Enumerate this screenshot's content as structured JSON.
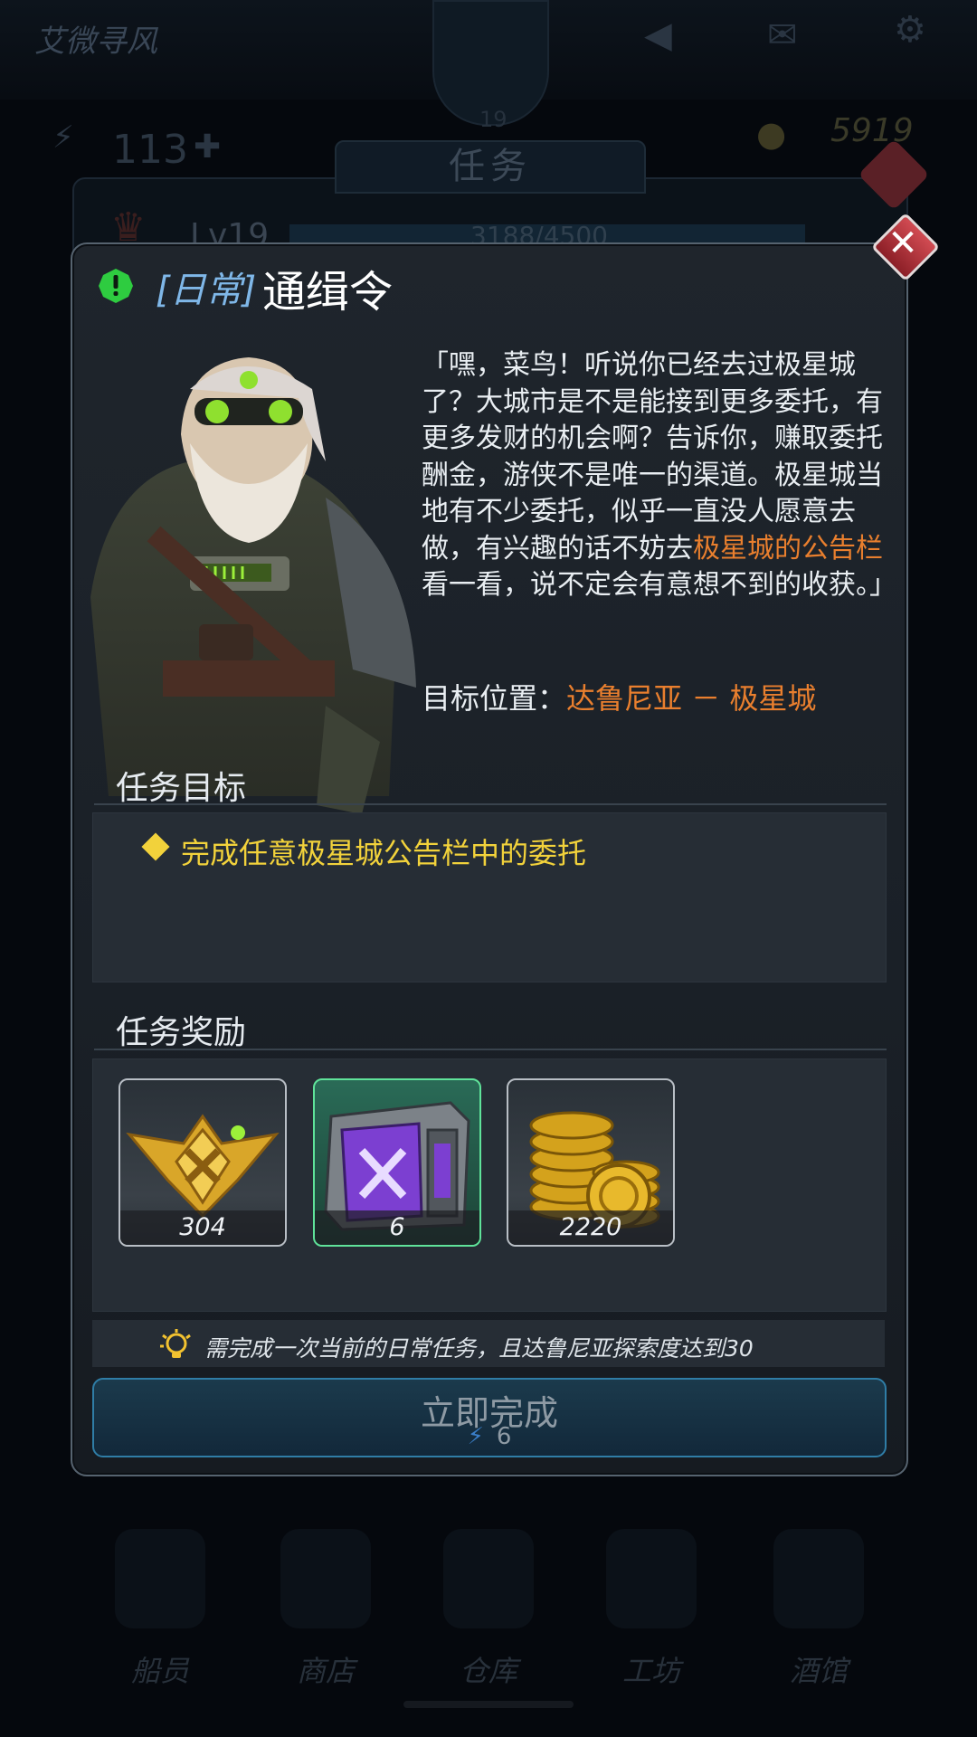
{
  "background": {
    "app_title": "艾微寻风",
    "level_badge": "19",
    "energy_value": "113",
    "coins": "5919",
    "level": "Lv19",
    "xp": "3188/4500",
    "dialog_tab": "任务",
    "nav": [
      "船员",
      "商店",
      "仓库",
      "工坊",
      "酒馆"
    ]
  },
  "dialog": {
    "tag": "[日常]",
    "title": "通缉令",
    "dialogue_before": "「嘿，菜鸟！听说你已经去过极星城了？大城市是不是能接到更多委托，有更多发财的机会啊？告诉你，赚取委托酬金，游侠不是唯一的渠道。极星城当地有不少委托，似乎一直没人愿意去做，有兴趣的话不妨去",
    "dialogue_highlight": "极星城的公告栏",
    "dialogue_after": "看一看，说不定会有意想不到的收获。」",
    "target_label": "目标位置：",
    "target_value": "达鲁尼亚 － 极星城",
    "objective_header": "任务目标",
    "objective_text": "完成任意极星城公告栏中的委托",
    "reward_header": "任务奖励",
    "rewards": [
      {
        "name": "emblem",
        "count": "304"
      },
      {
        "name": "purple-crate",
        "count": "6"
      },
      {
        "name": "gold-coins",
        "count": "2220"
      }
    ],
    "hint": "需完成一次当前的日常任务，且达鲁尼亚探索度达到30",
    "complete_button": "立即完成",
    "complete_cost": "6"
  },
  "colors": {
    "accent_orange": "#e97f2e",
    "objective_yellow": "#f2d23b",
    "tag_blue": "#7fb7e8",
    "close_red": "#c0363e",
    "alert_green": "#2ecc40"
  }
}
